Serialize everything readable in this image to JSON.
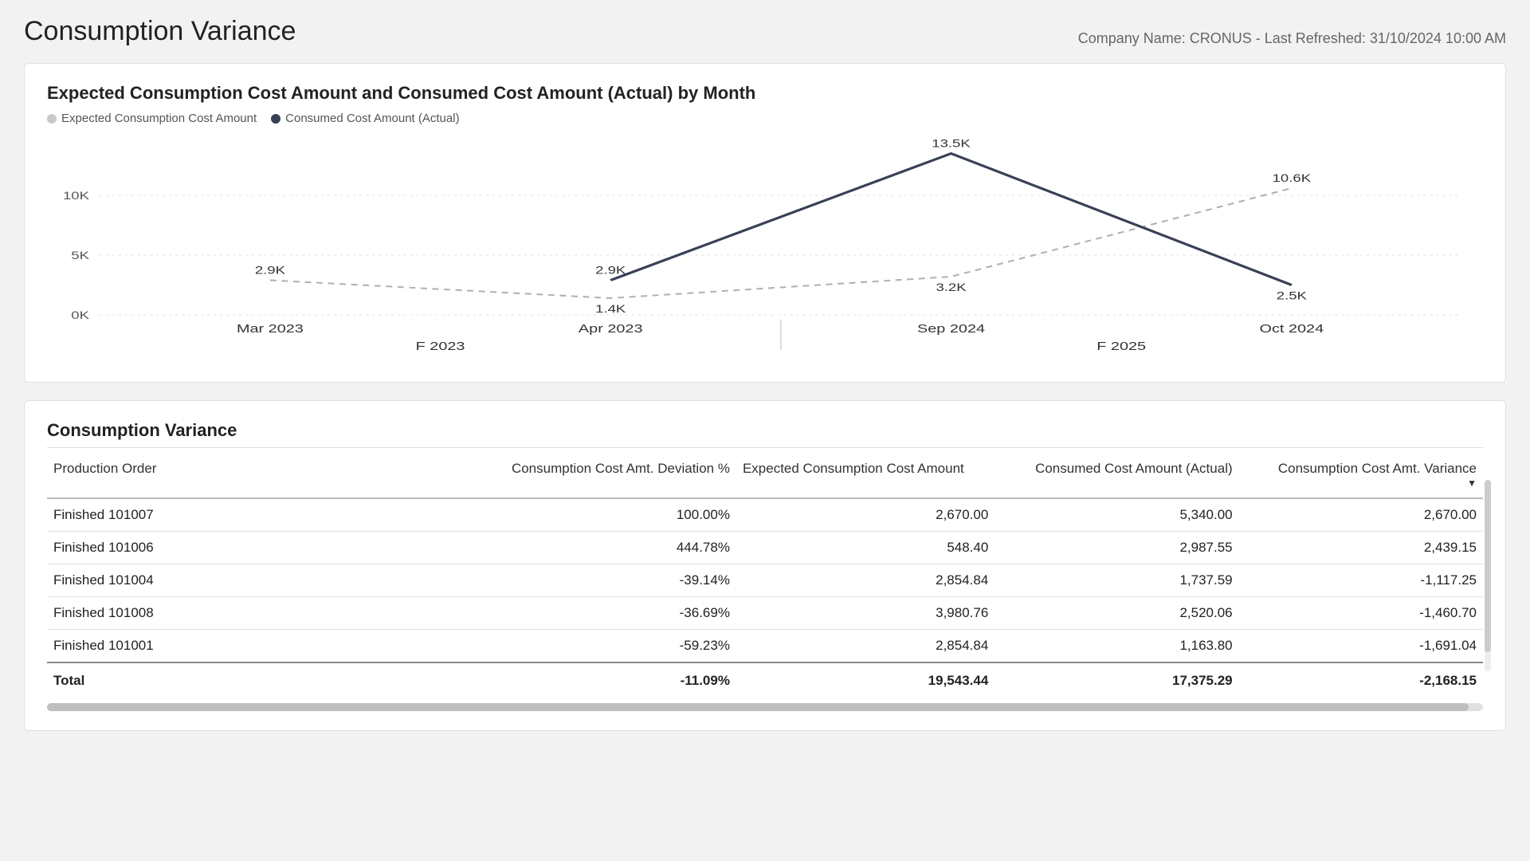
{
  "header": {
    "title": "Consumption Variance",
    "company_info": "Company Name: CRONUS - Last Refreshed: 31/10/2024 10:00 AM"
  },
  "chart_data": {
    "type": "line",
    "title": "Expected Consumption Cost Amount and Consumed Cost Amount (Actual) by Month",
    "xlabel": "",
    "ylabel": "",
    "ylim": [
      0,
      14000
    ],
    "y_ticks": [
      {
        "v": 0,
        "label": "0K"
      },
      {
        "v": 5000,
        "label": "5K"
      },
      {
        "v": 10000,
        "label": "10K"
      }
    ],
    "categories": [
      "Mar 2023",
      "Apr 2023",
      "Sep 2024",
      "Oct 2024"
    ],
    "category_groups": [
      {
        "label": "F 2023",
        "span": [
          0,
          1
        ]
      },
      {
        "label": "F 2025",
        "span": [
          2,
          3
        ]
      }
    ],
    "series": [
      {
        "name": "Expected Consumption Cost Amount",
        "style": "dashed",
        "color": "#b0b0b0",
        "values": [
          2900,
          1400,
          3200,
          10600
        ],
        "labels": [
          "2.9K",
          "1.4K",
          "3.2K",
          "10.6K"
        ],
        "label_pos": [
          "above",
          "below",
          "below",
          "above"
        ]
      },
      {
        "name": "Consumed Cost Amount (Actual)",
        "style": "solid",
        "color": "#384055",
        "values": [
          null,
          2900,
          13500,
          2500
        ],
        "labels": [
          null,
          "2.9K",
          "13.5K",
          "2.5K"
        ],
        "label_pos": [
          null,
          "above",
          "above",
          "below"
        ]
      }
    ]
  },
  "table": {
    "title": "Consumption Variance",
    "columns": [
      {
        "key": "order",
        "label": "Production Order",
        "align": "left"
      },
      {
        "key": "dev",
        "label": "Consumption Cost Amt. Deviation %",
        "align": "right"
      },
      {
        "key": "expected",
        "label": "Expected Consumption Cost Amount",
        "align": "left"
      },
      {
        "key": "actual",
        "label": "Consumed Cost Amount (Actual)",
        "align": "right"
      },
      {
        "key": "variance",
        "label": "Consumption Cost Amt. Variance",
        "align": "right",
        "sorted": "desc"
      }
    ],
    "rows": [
      {
        "order": "Finished 101007",
        "dev": "100.00%",
        "expected": "2,670.00",
        "actual": "5,340.00",
        "variance": "2,670.00"
      },
      {
        "order": "Finished 101006",
        "dev": "444.78%",
        "expected": "548.40",
        "actual": "2,987.55",
        "variance": "2,439.15"
      },
      {
        "order": "Finished 101004",
        "dev": "-39.14%",
        "expected": "2,854.84",
        "actual": "1,737.59",
        "variance": "-1,117.25"
      },
      {
        "order": "Finished 101008",
        "dev": "-36.69%",
        "expected": "3,980.76",
        "actual": "2,520.06",
        "variance": "-1,460.70"
      },
      {
        "order": "Finished 101001",
        "dev": "-59.23%",
        "expected": "2,854.84",
        "actual": "1,163.80",
        "variance": "-1,691.04"
      }
    ],
    "total": {
      "label": "Total",
      "dev": "-11.09%",
      "expected": "19,543.44",
      "actual": "17,375.29",
      "variance": "-2,168.15"
    }
  }
}
